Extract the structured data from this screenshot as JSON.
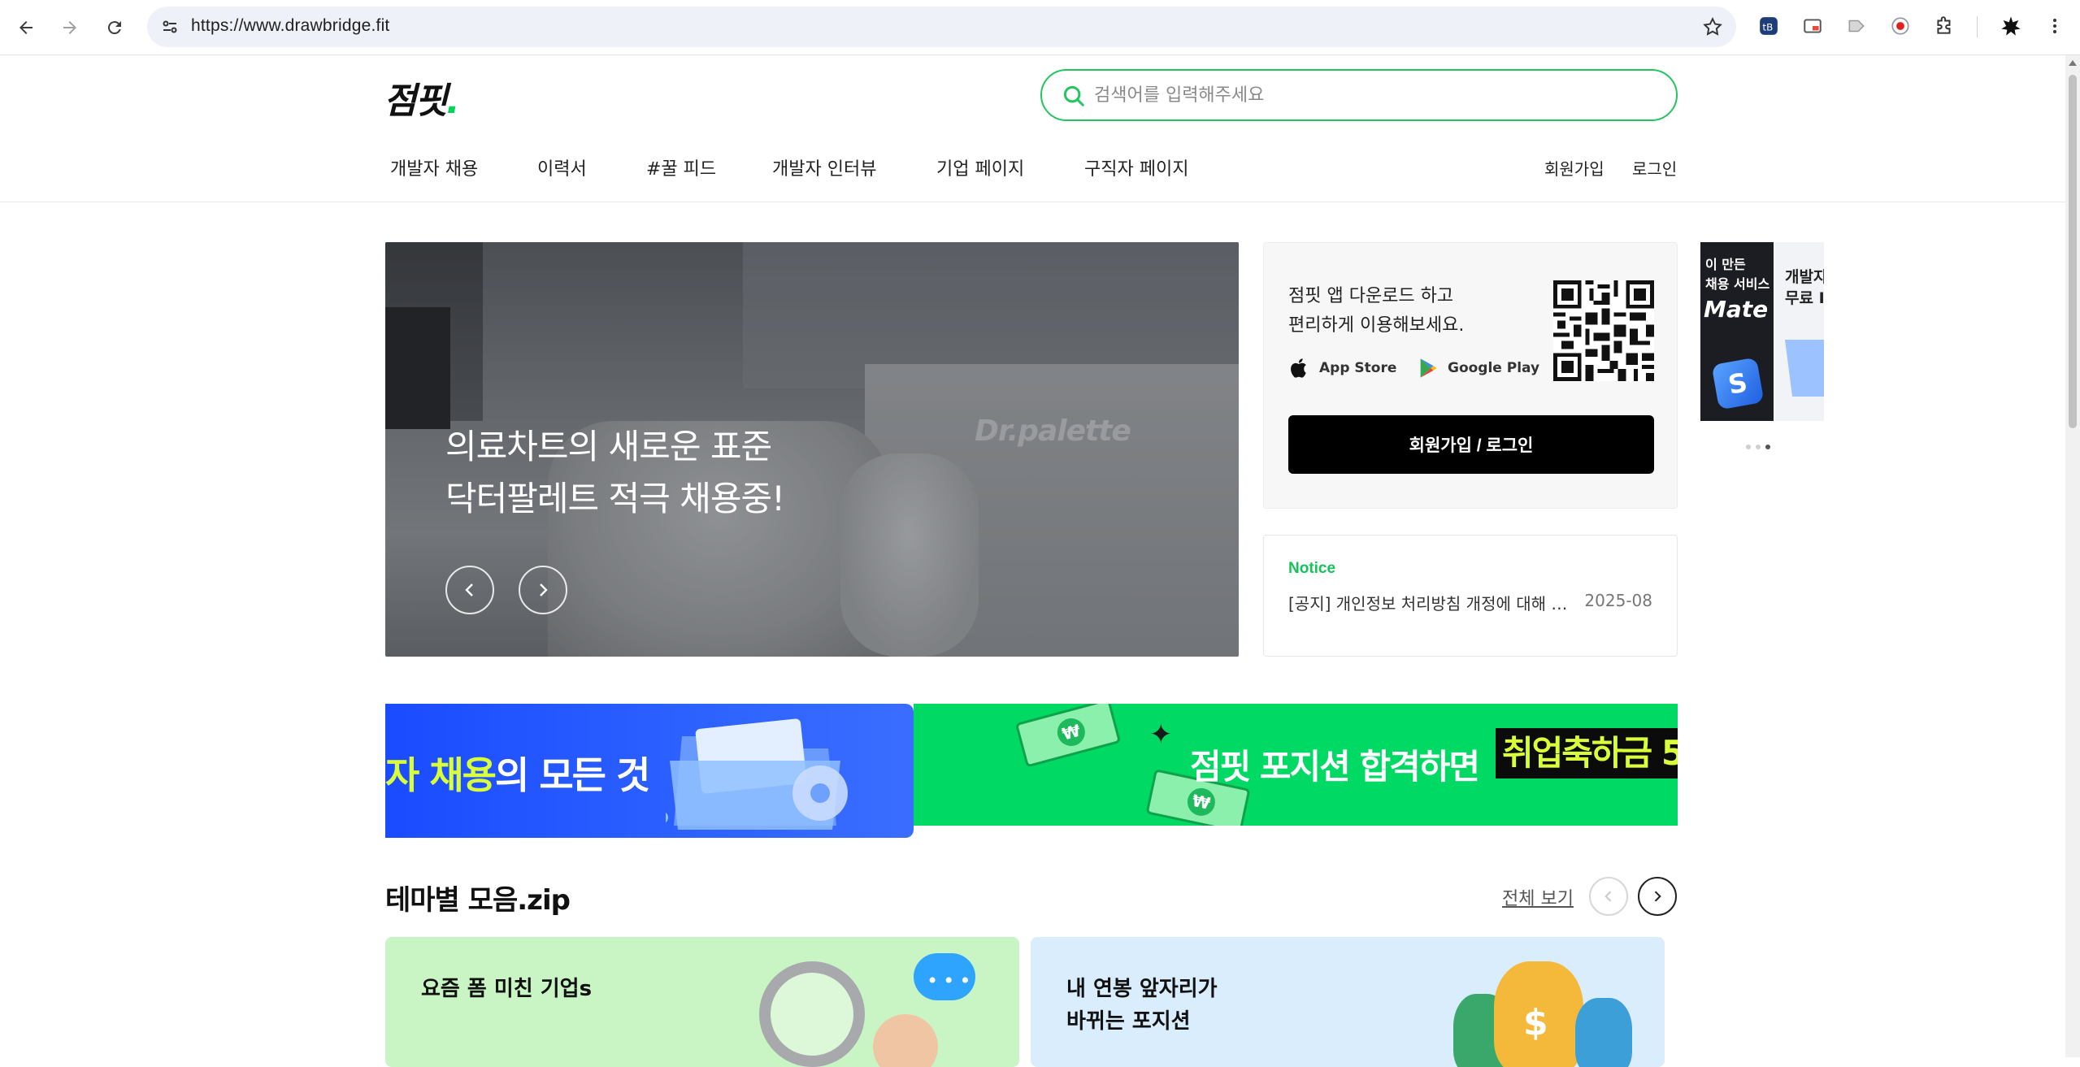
{
  "browser": {
    "url": "https://www.drawbridge.fit",
    "icons": [
      "back-icon",
      "forward-icon",
      "reload-icon",
      "site-settings-icon",
      "bookmark-star-icon",
      "extension-icons",
      "puzzle-icon",
      "profile-icon",
      "menu-icon"
    ]
  },
  "header": {
    "logo": "점핏",
    "logo_dot": ".",
    "search_placeholder": "검색어를 입력해주세요",
    "nav": [
      "개발자 채용",
      "이력서",
      "#꿀 피드",
      "개발자 인터뷰",
      "기업 페이지",
      "구직자 페이지"
    ],
    "signup": "회원가입",
    "login": "로그인"
  },
  "hero": {
    "line1": "의료차트의 새로운 표준",
    "line2": "닥터팔레트 적극 채용중!",
    "brand_sign": "Dr.palette"
  },
  "app_card": {
    "line1": "점핏 앱 다운로드 하고",
    "line2": "편리하게 이용해보세요.",
    "app_store": "App Store",
    "google_play": "Google Play",
    "signup_button": "회원가입 / 로그인"
  },
  "mini_banner": {
    "a_line1": "이 만든",
    "a_line2": "채용 서비스",
    "a_big": "Mate",
    "a_logo": "S",
    "b_line1": "개발자",
    "b_line2": "무료 I",
    "dots": 3,
    "active_dot": 3
  },
  "notice": {
    "label": "Notice",
    "title": "[공지] 개인정보 처리방침 개정에 대해 안내드립니다",
    "date": "2025-08"
  },
  "promos": {
    "blue_highlight": "자 채용",
    "blue_rest": "의 모든 것",
    "green_text": "점핏 포지션 합격하면",
    "green_highlight": "취업축하금 5"
  },
  "theme_section": {
    "title": "테마별 모음.zip",
    "view_all": "전체 보기",
    "cards": [
      {
        "line1": "요즘 폼 미친 기업s",
        "line2": ""
      },
      {
        "line1": "내 연봉 앞자리가",
        "line2": "바뀌는 포지션"
      }
    ]
  },
  "colors": {
    "brand_green": "#00d964",
    "accent_lime": "#d8ff3a",
    "promo_blue": "#2d62ff",
    "notice_green": "#16c25a"
  }
}
